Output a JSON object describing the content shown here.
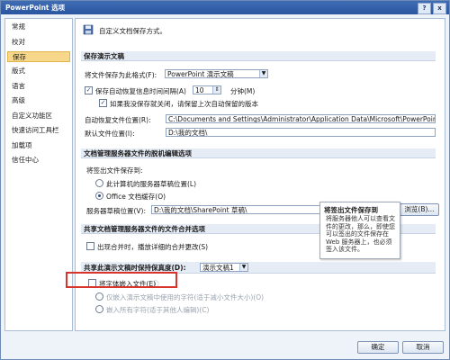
{
  "window": {
    "title": "PowerPoint 选项",
    "help": "?",
    "close": "x"
  },
  "sidebar": {
    "items": [
      "常规",
      "校对",
      "保存",
      "版式",
      "语言",
      "高级",
      "自定义功能区",
      "快速访问工具栏",
      "加载项",
      "信任中心"
    ],
    "active_index": 2
  },
  "header": {
    "text": "自定义文档保存方式。"
  },
  "save_presentations": {
    "section": "保存演示文稿",
    "format_label": "将文件保存为此格式(F):",
    "format_value": "PowerPoint 演示文稿",
    "autorecover_label": "保存自动恢复信息时间间隔(A)",
    "autorecover_minutes": "10",
    "minutes_unit": "分钟(M)",
    "keep_last_label": "如果我没保存就关闭，请保留上次自动保留的版本",
    "autorecover_location_label": "自动恢复文件位置(R):",
    "autorecover_location_value": "C:\\Documents and Settings\\Administrator\\Application Data\\Microsoft\\PowerPoint\\",
    "default_location_label": "默认文件位置(I):",
    "default_location_value": "D:\\我的文档\\"
  },
  "offline_editing": {
    "section": "文档管理服务器文件的脱机编辑选项",
    "save_checked_out_label": "将签出文件保存到:",
    "option1": "此计算机的服务器草稿位置(L)",
    "option2": "Office 文档缓存(O)",
    "drafts_location_label": "服务器草稿位置(V):",
    "drafts_location_value": "D:\\我的文档\\SharePoint 草稿\\",
    "browse_button": "浏览(B)..."
  },
  "merge": {
    "section": "共享文档管理服务器文件的文件合并选项",
    "merge_label": "出现合并时，播放详细的合并更改(S)"
  },
  "fidelity": {
    "section_label": "共享此演示文稿时保持保真度(D):",
    "presentation_value": "演示文稿1",
    "embed_fonts_label": "将字体嵌入文件(E)",
    "embed_option1": "仅嵌入演示文稿中使用的字符(适于减小文件大小)(O)",
    "embed_option2": "嵌入所有字符(适于其他人编辑)(C)"
  },
  "tooltip": {
    "title": "将签出文件保存到",
    "body": "将服务器他人可以查看文件的更改，那么，即使您可以签出的文件保存在 Web 服务器上，也必须签入该文件。"
  },
  "footer": {
    "ok": "确定",
    "cancel": "取消"
  },
  "colors": {
    "title_bar": "#2a55a0",
    "active_nav": "#f7d88a",
    "highlight": "#d9342b"
  }
}
